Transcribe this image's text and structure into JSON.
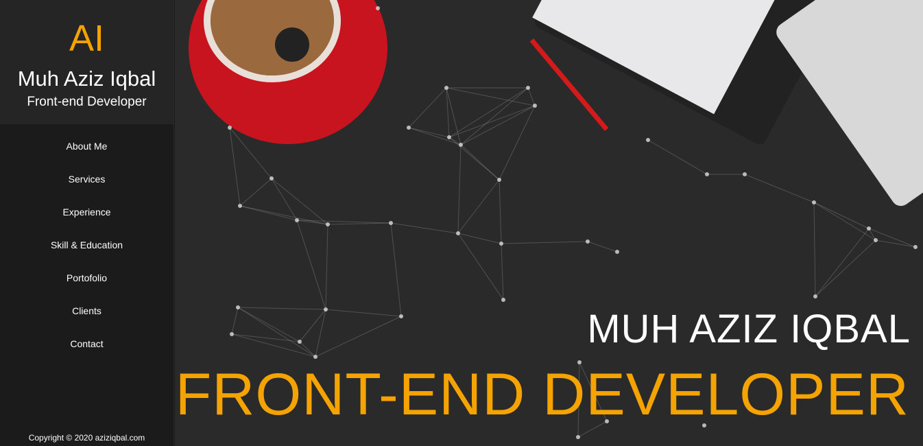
{
  "sidebar": {
    "logo": "AI",
    "name": "Muh Aziz Iqbal",
    "role": "Front-end Developer",
    "nav": [
      "About Me",
      "Services",
      "Experience",
      "Skill & Education",
      "Portofolio",
      "Clients",
      "Contact"
    ],
    "copyright": "Copyright © 2020 aziziqbal.com"
  },
  "hero": {
    "title": "MUH AZIZ IQBAL",
    "subtitle": "FRONT-END DEVELOPER"
  },
  "colors": {
    "accent": "#f5a300",
    "sidebar": "#1b1b1b",
    "brand_bg": "#252525"
  }
}
